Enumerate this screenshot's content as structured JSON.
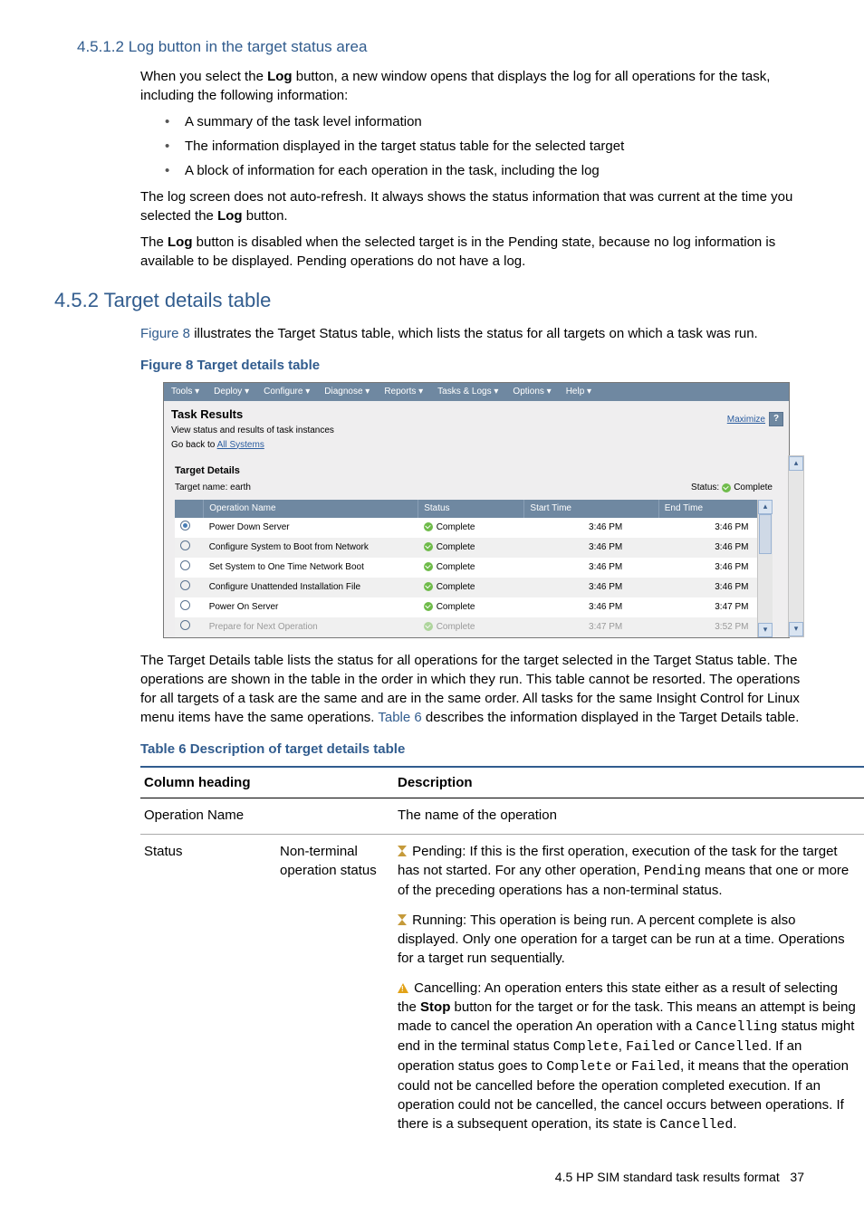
{
  "sec_4512": {
    "heading": "4.5.1.2 Log button in the target status area",
    "p1a": "When you select the ",
    "p1b": " button, a new window opens that displays the log for all operations for the task, including the following information:",
    "log_word": "Log",
    "bullets": [
      "A summary of the task level information",
      "The information displayed in the target status table for the selected target",
      "A block of information for each operation in the task, including the log"
    ],
    "p2a": "The log screen does not auto-refresh. It always shows the status information that was current at the time you selected the ",
    "p2b": " button.",
    "p3a": "The ",
    "p3b": " button is disabled when the selected target is in the Pending state, because no log information is available to be displayed. Pending operations do not have a log."
  },
  "sec_452": {
    "heading": "4.5.2 Target details table",
    "p1a": "Figure 8",
    "p1b": " illustrates the Target Status table, which lists the status for all targets on which a task was run.",
    "fig_caption": "Figure 8 Target details table",
    "p2a": "The Target Details table lists the status for all operations for the target selected in the Target Status table. The operations are shown in the table in the order in which they run. This table cannot be resorted. The operations for all targets of a task are the same and are in the same order. All tasks for the same Insight Control for Linux menu items have the same operations. ",
    "p2link": "Table 6",
    "p2b": " describes the information displayed in the Target Details table.",
    "tbl_caption": "Table 6 Description of target details table"
  },
  "figure": {
    "menubar": [
      "Tools ▾",
      "Deploy ▾",
      "Configure ▾",
      "Diagnose ▾",
      "Reports ▾",
      "Tasks & Logs ▾",
      "Options ▾",
      "Help ▾"
    ],
    "title": "Task Results",
    "sub1": "View status and results of task instances",
    "sub2_label": "Go back to ",
    "sub2_link": "All Systems",
    "maximize": "Maximize",
    "help_q": "?",
    "target_details": "Target Details",
    "target_name_label": "Target name: ",
    "target_name": "earth",
    "status_label": "Status: ",
    "status_value": "Complete",
    "columns": [
      "",
      "Operation Name",
      "Status",
      "Start Time",
      "End Time"
    ],
    "rows": [
      {
        "sel": true,
        "op": "Power Down Server",
        "stat": "Complete",
        "start": "3:46 PM",
        "end": "3:46 PM"
      },
      {
        "sel": false,
        "op": "Configure System to Boot from Network",
        "stat": "Complete",
        "start": "3:46 PM",
        "end": "3:46 PM"
      },
      {
        "sel": false,
        "op": "Set System to One Time Network Boot",
        "stat": "Complete",
        "start": "3:46 PM",
        "end": "3:46 PM"
      },
      {
        "sel": false,
        "op": "Configure Unattended Installation File",
        "stat": "Complete",
        "start": "3:46 PM",
        "end": "3:46 PM"
      },
      {
        "sel": false,
        "op": "Power On Server",
        "stat": "Complete",
        "start": "3:46 PM",
        "end": "3:47 PM"
      },
      {
        "sel": false,
        "op": "Prepare for Next Operation",
        "stat": "Complete",
        "start": "3:47 PM",
        "end": "3:52 PM"
      }
    ]
  },
  "table6": {
    "headers": [
      "Column heading",
      "",
      "Description"
    ],
    "row1_c1": "Operation Name",
    "row1_c3": "The name of the operation",
    "row2_c1": "Status",
    "row2_c2": "Non-terminal operation status",
    "pending_label": " Pending: If this is the first operation, execution of the task for the target has not started. For any other operation, ",
    "pending_code": "Pending",
    "pending_tail": " means that one or more of the preceding operations has a non-terminal status.",
    "running_text": " Running: This operation is being run. A percent complete is also displayed. Only one operation for a target can be run at a time. Operations for a target run sequentially.",
    "cancel_a": " Cancelling: An operation enters this state either as a result of selecting the ",
    "cancel_stop": "Stop",
    "cancel_b": " button for the target or for the task. This means an attempt is being made to cancel the operation An operation with a ",
    "cancel_code1": "Cancelling",
    "cancel_c": " status might end in the terminal status ",
    "cancel_code2": "Complete",
    "cancel_d": ", ",
    "cancel_code3": "Failed",
    "cancel_e": " or ",
    "cancel_code4": "Cancelled",
    "cancel_f": ". If an operation status goes to ",
    "cancel_code5": "Complete",
    "cancel_g": " or ",
    "cancel_code6": "Failed",
    "cancel_h": ", it means that the operation could not be cancelled before the operation completed execution. If an operation could not be cancelled, the cancel occurs between operations. If there is a subsequent operation, its state is ",
    "cancel_code7": "Cancelled",
    "cancel_i": "."
  },
  "footer": {
    "text": "4.5 HP SIM standard task results format",
    "page": "37"
  }
}
